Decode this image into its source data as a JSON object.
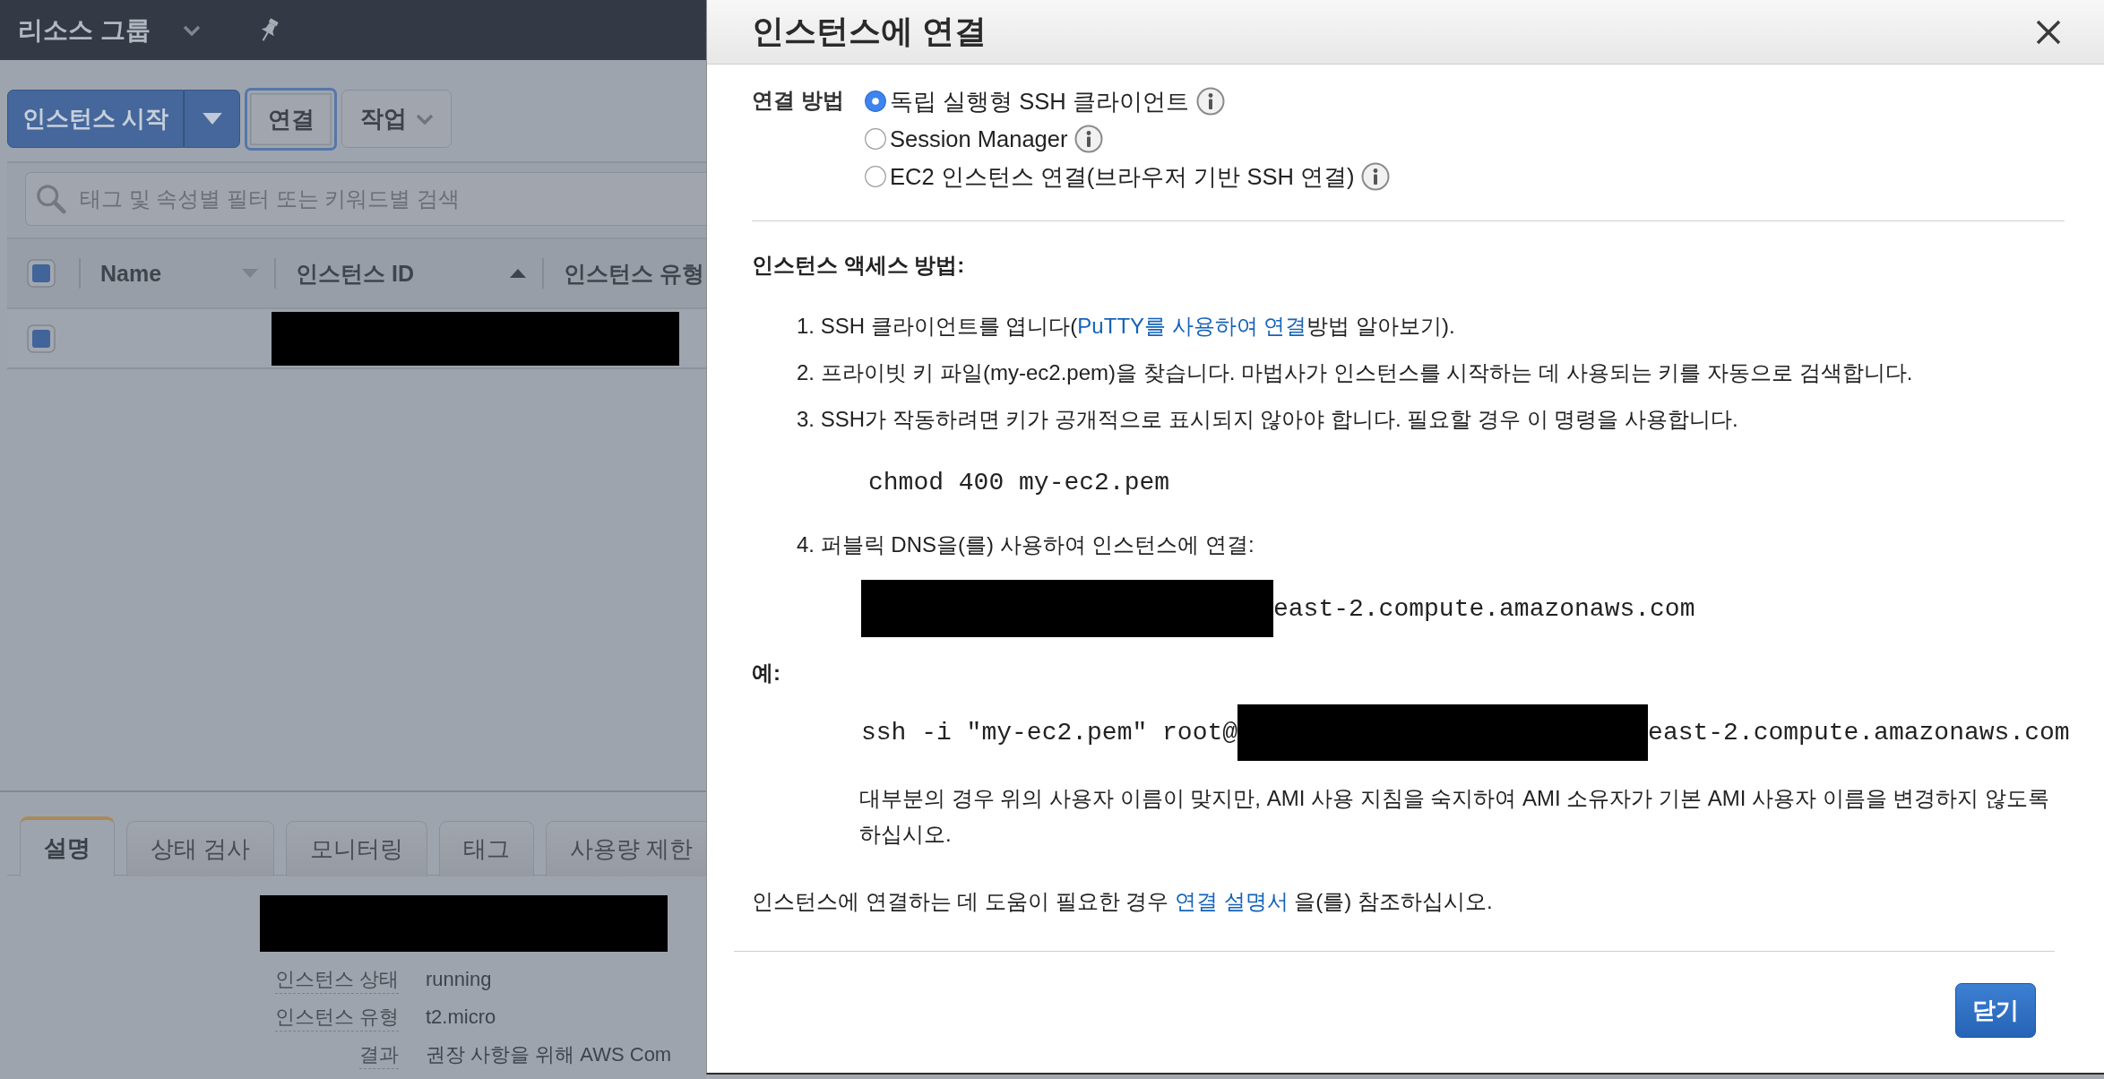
{
  "top_nav": {
    "title": "리소스 그룹"
  },
  "toolbar": {
    "buttons": [
      {
        "kind": "split",
        "label": "인스턴스 시작"
      },
      {
        "kind": "focused",
        "label": "연결"
      },
      {
        "kind": "menu",
        "label": "작업"
      }
    ]
  },
  "search": {
    "placeholder": "태그 및 속성별 필터 또는 키워드별 검색"
  },
  "table": {
    "select_all": {
      "checked": true
    },
    "columns": [
      {
        "label": "Name",
        "kind": "dropdown"
      },
      {
        "label": "인스턴스 ID",
        "kind": "sorted"
      },
      {
        "label": "인스턴스 유형",
        "kind": "plain"
      }
    ],
    "rows": [
      {
        "selected": true
      }
    ]
  },
  "detail_tabs": [
    {
      "label": "설명",
      "selected": true
    },
    {
      "label": "상태 검사",
      "selected": false
    },
    {
      "label": "모니터링",
      "selected": false
    },
    {
      "label": "태그",
      "selected": false
    },
    {
      "label": "사용량 제한",
      "selected": false
    }
  ],
  "details": [
    {
      "label": "인스턴스 상태",
      "value": "running"
    },
    {
      "label": "인스턴스 유형",
      "value": "t2.micro"
    },
    {
      "label": "결과",
      "value": "권장 사항을 위해 AWS Com"
    }
  ],
  "modal": {
    "title": "인스턴스에 연결",
    "connection_method": {
      "label": "연결 방법",
      "options": [
        {
          "label": "독립 실행형 SSH 클라이언트",
          "selected": true
        },
        {
          "label": "Session Manager",
          "selected": false
        },
        {
          "label": "EC2 인스턴스 연결(브라우저 기반 SSH 연결)",
          "selected": false
        }
      ]
    },
    "access_heading": "인스턴스 액세스 방법:",
    "steps": [
      {
        "number": "1.",
        "text": "SSH 클라이언트를 엽니다(",
        "link": "PuTTY를 사용하여 연결",
        "text_after": "방법 알아보기)."
      },
      {
        "number": "2.",
        "text": "프라이빗 키 파일(my-ec2.pem)을 찾습니다. 마법사가 인스턴스를 시작하는 데 사용되는 키를 자동으로 검색합니다."
      },
      {
        "number": "3.",
        "text": "SSH가 작동하려면 키가 공개적으로 표시되지 않아야 합니다. 필요할 경우 이 명령을 사용합니다.",
        "code": "chmod 400 my-ec2.pem"
      },
      {
        "number": "4.",
        "text": "퍼블릭 DNS을(를) 사용하여 인스턴스에 연결:",
        "host_suffix": "east-2.compute.amazonaws.com"
      }
    ],
    "example": {
      "label": "예:",
      "command_prefix": "ssh -i \"my-ec2.pem\" root@",
      "host_suffix": "east-2.compute.amazonaws.com",
      "note": "대부분의 경우 위의 사용자 이름이 맞지만, AMI 사용 지침을 숙지하여 AMI 소유자가 기본 AMI 사용자 이름을 변경하지 않도록 하십시오."
    },
    "help": {
      "text_before": "인스턴스에 연결하는 데 도움이 필요한 경우",
      "link": "연결 설명서",
      "text_after": "을(를) 참조하십시오."
    },
    "footer_button": "닫기"
  }
}
